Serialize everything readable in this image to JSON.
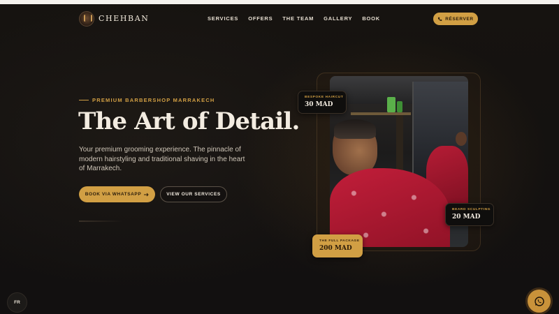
{
  "nav": {
    "brand": "CHEHBAN",
    "links": [
      "SERVICES",
      "OFFERS",
      "THE TEAM",
      "GALLERY",
      "BOOK"
    ],
    "reserve_label": "RÉSERVER"
  },
  "hero": {
    "eyebrow": "PREMIUM BARBERSHOP MARRAKECH",
    "title": "The Art of Detail.",
    "subtitle": "Your premium grooming experience. The pinnacle of modern hairstyling and traditional shaving in the heart of Marrakech.",
    "primary_cta": "BOOK VIA WHATSAPP",
    "secondary_cta": "VIEW OUR SERVICES"
  },
  "price_tags": [
    {
      "label": "BESPOKE HAIRCUT",
      "price": "30 MAD"
    },
    {
      "label": "BEARD SCULPTING",
      "price": "20 MAD"
    },
    {
      "label": "THE FULL PACKAGE",
      "price": "200 MAD"
    }
  ],
  "floating": {
    "language": "FR"
  },
  "colors": {
    "accent": "#d19f44",
    "background": "#141210",
    "cape_red": "#c21e3a"
  },
  "icons": [
    "logo-badge",
    "phone-icon",
    "arrow-right-icon",
    "whatsapp-icon"
  ]
}
